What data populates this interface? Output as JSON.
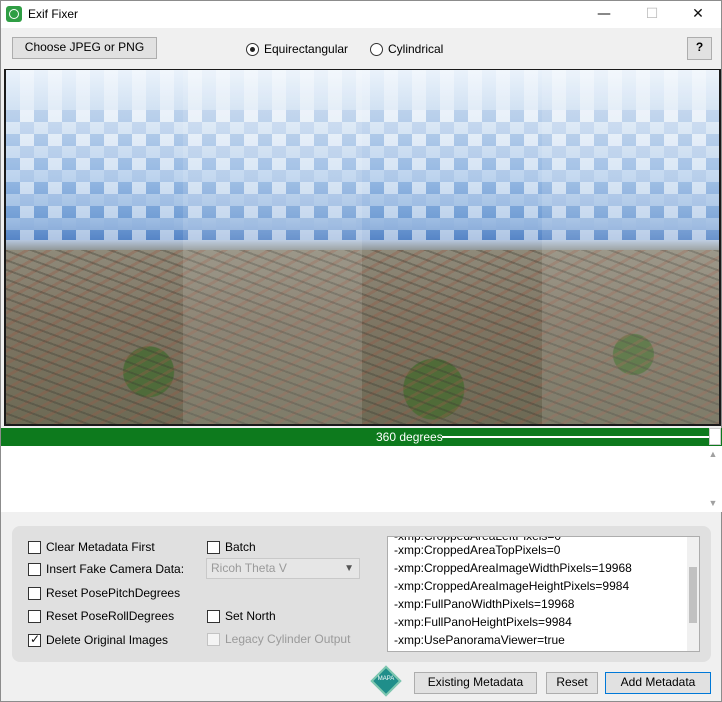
{
  "window": {
    "title": "Exif Fixer",
    "minimize": "—",
    "maximize": "☐",
    "close": "✕"
  },
  "toolbar": {
    "choose_button": "Choose JPEG or PNG",
    "projection_options": [
      {
        "label": "Equirectangular",
        "selected": true
      },
      {
        "label": "Cylindrical",
        "selected": false
      }
    ],
    "help_button": "?"
  },
  "panorama": {
    "degree_label": "360 degrees",
    "degrees_value": 360
  },
  "options": {
    "clear_metadata_first": {
      "label": "Clear Metadata First",
      "checked": false
    },
    "insert_fake_camera": {
      "label": "Insert Fake Camera Data:",
      "checked": false
    },
    "reset_pose_pitch": {
      "label": "Reset PosePitchDegrees",
      "checked": false
    },
    "reset_pose_roll": {
      "label": "Reset PoseRollDegrees",
      "checked": false
    },
    "delete_original": {
      "label": "Delete Original Images",
      "checked": true
    },
    "batch": {
      "label": "Batch",
      "checked": false
    },
    "camera_model": {
      "selected": "Ricoh Theta V",
      "enabled": false
    },
    "set_north": {
      "label": "Set North",
      "checked": false
    },
    "legacy_cylinder": {
      "label": "Legacy Cylinder Output",
      "checked": false,
      "enabled": false
    }
  },
  "metadata_lines": [
    "-xmp:CroppedAreaTopPixels=0",
    "-xmp:CroppedAreaImageWidthPixels=19968",
    "-xmp:CroppedAreaImageHeightPixels=9984",
    "-xmp:FullPanoWidthPixels=19968",
    "-xmp:FullPanoHeightPixels=9984",
    "-xmp:UsePanoramaViewer=true"
  ],
  "bottom": {
    "logo_text": "MAPA",
    "existing_metadata_button": "Existing Metadata",
    "reset_button": "Reset",
    "add_metadata_button": "Add Metadata"
  },
  "colors": {
    "degree_bar": "#0d7a1d",
    "app_icon": "#2f9e44",
    "accent_border": "#0078d7"
  }
}
